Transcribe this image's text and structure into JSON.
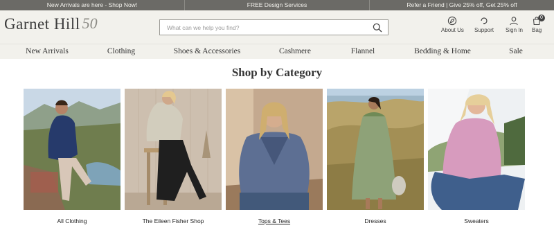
{
  "promo": {
    "items": [
      "New Arrivals are here - Shop Now!",
      "FREE Design Services",
      "Refer a Friend | Give 25% off, Get 25% off"
    ]
  },
  "header": {
    "logo_text": "Garnet Hill",
    "logo_badge": "50",
    "search_placeholder": "What can we help you find?",
    "utilities": {
      "about": "About Us",
      "support": "Support",
      "signin": "Sign In",
      "bag": "Bag",
      "bag_count": "0"
    }
  },
  "nav": {
    "items": [
      "New Arrivals",
      "Clothing",
      "Shoes & Accessories",
      "Cashmere",
      "Flannel",
      "Bedding & Home",
      "Sale"
    ]
  },
  "main": {
    "heading": "Shop by Category",
    "categories": [
      {
        "label": "All Clothing"
      },
      {
        "label": "The Eileen Fisher Shop"
      },
      {
        "label": "Tops & Tees"
      },
      {
        "label": "Dresses"
      },
      {
        "label": "Sweaters"
      }
    ]
  },
  "colors": {
    "promo_bg": "#6b6a66",
    "header_bg": "#f2f1ec",
    "text": "#333333"
  }
}
